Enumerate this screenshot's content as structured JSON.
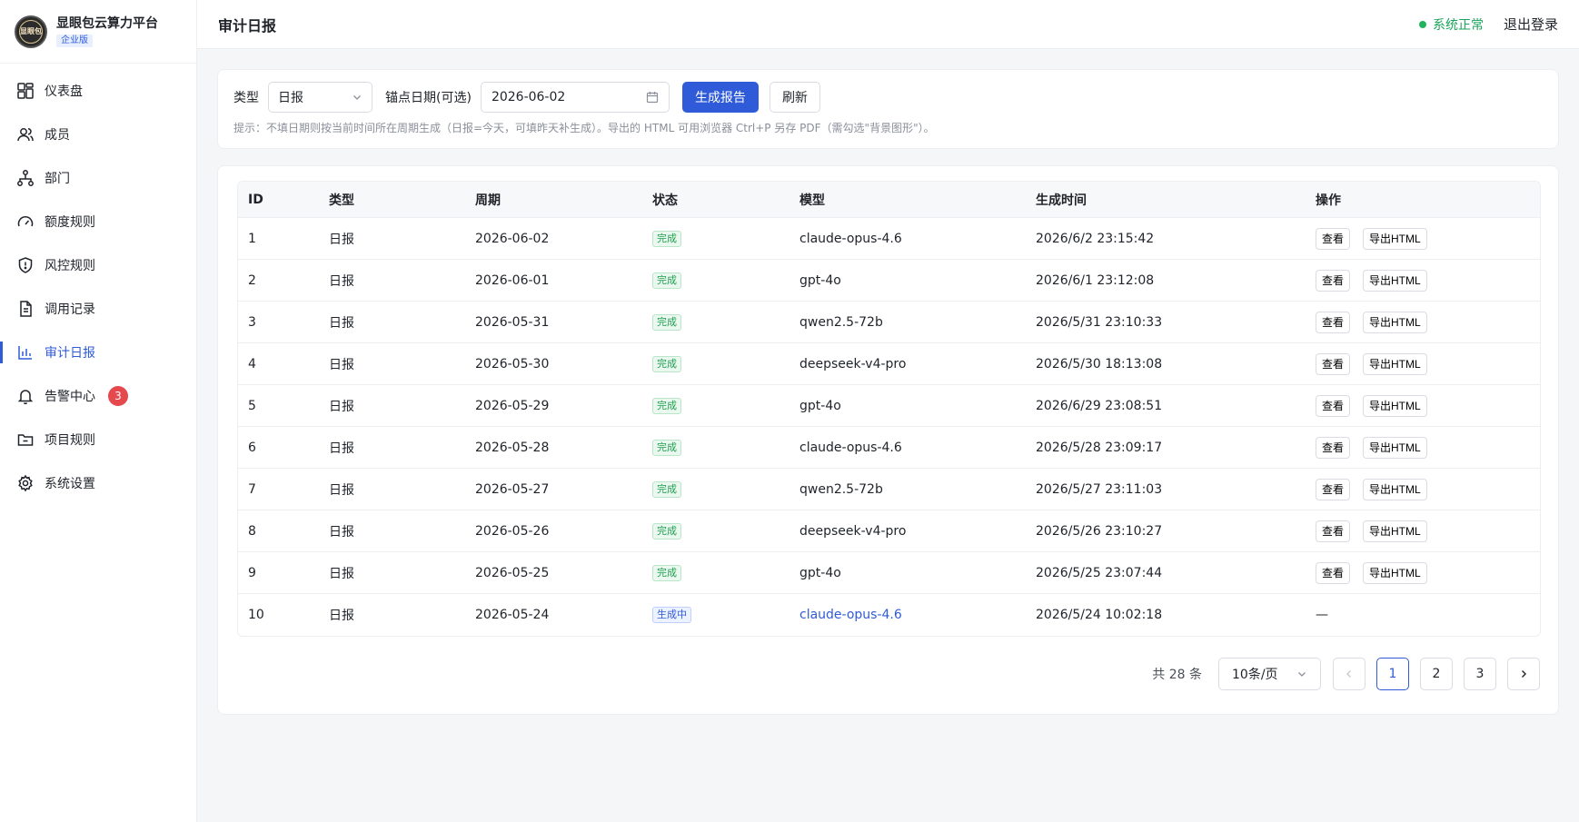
{
  "brand": {
    "name": "显眼包云算力平台",
    "badge": "企业版",
    "logo_text": "显眼包"
  },
  "sidebar": {
    "items": [
      {
        "label": "仪表盘",
        "icon": "dashboard-icon"
      },
      {
        "label": "成员",
        "icon": "users-icon"
      },
      {
        "label": "部门",
        "icon": "org-icon"
      },
      {
        "label": "额度规则",
        "icon": "gauge-icon"
      },
      {
        "label": "风控规则",
        "icon": "shield-icon"
      },
      {
        "label": "调用记录",
        "icon": "document-icon"
      },
      {
        "label": "审计日报",
        "icon": "bar-chart-icon",
        "active": true
      },
      {
        "label": "告警中心",
        "icon": "bell-icon",
        "badge": "3"
      },
      {
        "label": "项目规则",
        "icon": "folder-icon"
      },
      {
        "label": "系统设置",
        "icon": "gear-icon"
      }
    ]
  },
  "header": {
    "title": "审计日报",
    "status": "系统正常",
    "logout": "退出登录",
    "status_color": "#22b35e"
  },
  "filters": {
    "type_label": "类型",
    "type_value": "日报",
    "date_label": "锚点日期(可选)",
    "date_value": "2026-06-02",
    "generate_label": "生成报告",
    "refresh_label": "刷新",
    "hint": "提示：不填日期则按当前时间所在周期生成（日报=今天，可填昨天补生成）。导出的 HTML 可用浏览器 Ctrl+P 另存 PDF（需勾选\"背景图形\"）。"
  },
  "table": {
    "headers": {
      "id": "ID",
      "type": "类型",
      "period": "周期",
      "status": "状态",
      "model": "模型",
      "time": "生成时间",
      "ops": "操作"
    },
    "view_label": "查看",
    "export_label": "导出HTML",
    "rows": [
      {
        "id": "1",
        "type": "日报",
        "period": "2026-06-02",
        "status": "完成",
        "model": "claude-opus-4.6",
        "time": "2026/6/2 23:15:42"
      },
      {
        "id": "2",
        "type": "日报",
        "period": "2026-06-01",
        "status": "完成",
        "model": "gpt-4o",
        "time": "2026/6/1 23:12:08"
      },
      {
        "id": "3",
        "type": "日报",
        "period": "2026-05-31",
        "status": "完成",
        "model": "qwen2.5-72b",
        "time": "2026/5/31 23:10:33"
      },
      {
        "id": "4",
        "type": "日报",
        "period": "2026-05-30",
        "status": "完成",
        "model": "deepseek-v4-pro",
        "time": "2026/5/30 18:13:08"
      },
      {
        "id": "5",
        "type": "日报",
        "period": "2026-05-29",
        "status": "完成",
        "model": "gpt-4o",
        "time": "2026/6/29 23:08:51"
      },
      {
        "id": "6",
        "type": "日报",
        "period": "2026-05-28",
        "status": "完成",
        "model": "claude-opus-4.6",
        "time": "2026/5/28 23:09:17"
      },
      {
        "id": "7",
        "type": "日报",
        "period": "2026-05-27",
        "status": "完成",
        "model": "qwen2.5-72b",
        "time": "2026/5/27 23:11:03"
      },
      {
        "id": "8",
        "type": "日报",
        "period": "2026-05-26",
        "status": "完成",
        "model": "deepseek-v4-pro",
        "time": "2026/5/26 23:10:27"
      },
      {
        "id": "9",
        "type": "日报",
        "period": "2026-05-25",
        "status": "完成",
        "model": "gpt-4o",
        "time": "2026/5/25 23:07:44"
      },
      {
        "id": "10",
        "type": "日报",
        "period": "2026-05-24",
        "status": "生成中",
        "model": "claude-opus-4.6",
        "time": "2026/5/24 10:02:18",
        "ops": "—"
      }
    ]
  },
  "pagination": {
    "total": "共 28 条",
    "page_size": "10条/页",
    "pages": [
      "1",
      "2",
      "3"
    ],
    "current": "1"
  },
  "colors": {
    "accent": "#2f5bd8",
    "done": "#1e9e50",
    "danger": "#e5484d"
  }
}
